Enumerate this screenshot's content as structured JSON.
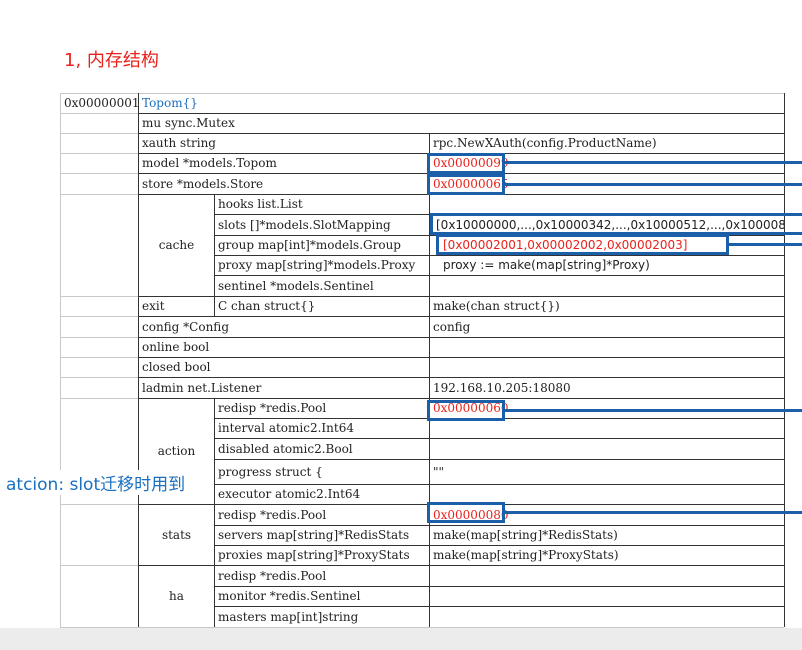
{
  "heading": "1, 内存结构",
  "annotation": "atcion: slot迁移时用到",
  "colors": {
    "accent_blue": "#1a5fa8",
    "text_red": "#e8221c",
    "title_blue": "#1e6fbf"
  },
  "address": "0x00000001",
  "title": "Topom{}",
  "rows": {
    "mu": "mu sync.Mutex",
    "xauth": "xauth string",
    "xauth_val": "rpc.NewXAuth(config.ProductName)",
    "model": "model *models.Topom",
    "model_val": "0x00000099",
    "store": "store *models.Store",
    "store_val": "0x00000065",
    "cache": "cache",
    "hooks": "hooks  list.List",
    "slots": "slots []*models.SlotMapping",
    "slots_val": "[0x10000000,...,0x10000342,...,0x10000512,...,0x100008",
    "group": "group map[int]*models.Group",
    "group_val": "[0x00002001,0x00002002,0x00002003]",
    "proxy": "proxy map[string]*models.Proxy",
    "proxy_val": "proxy := make(map[string]*Proxy)",
    "sentinel": "sentinel *models.Sentinel",
    "exit": "exit",
    "exit_c": "C chan struct{}",
    "exit_val": "make(chan struct{})",
    "config": "config *Config",
    "config_val": "config",
    "online": "online bool",
    "closed": "closed bool",
    "ladmin": "ladmin net.Listener",
    "ladmin_val": "192.168.10.205:18080",
    "action": "action",
    "action_redisp": "redisp *redis.Pool",
    "action_redisp_val": "0x00000060",
    "interval": "interval atomic2.Int64",
    "disabled": "disabled atomic2.Bool",
    "progress": "progress struct {",
    "progress_val": "\"\"",
    "executor": "executor atomic2.Int64",
    "stats": "stats",
    "stats_redisp": "redisp *redis.Pool",
    "stats_redisp_val": "0x00000080",
    "servers": "servers map[string]*RedisStats",
    "servers_val": "make(map[string]*RedisStats)",
    "proxies": "proxies map[string]*ProxyStats",
    "proxies_val": "make(map[string]*ProxyStats)",
    "ha": "ha",
    "ha_redisp": "redisp *redis.Pool",
    "monitor": "monitor *redis.Sentinel",
    "masters": "masters map[int]string"
  }
}
